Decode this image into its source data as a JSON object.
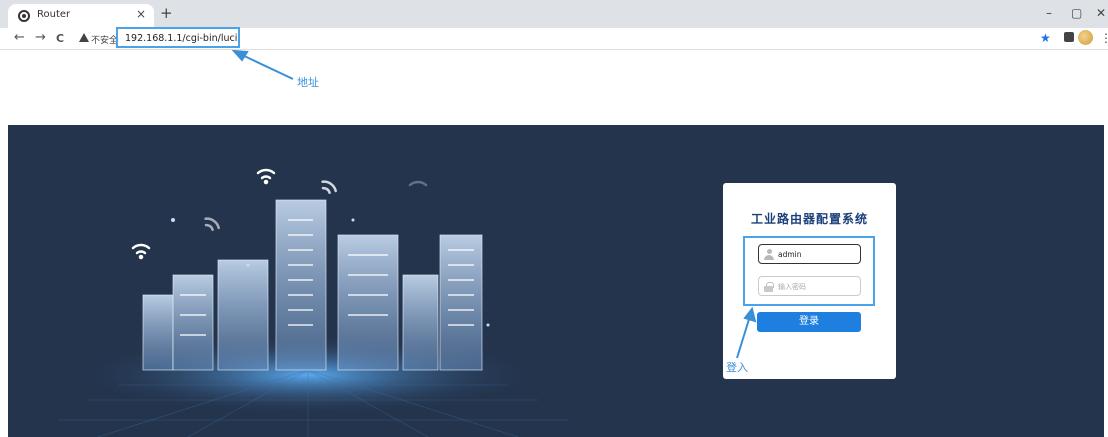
{
  "browser": {
    "tab_title": "Router",
    "tab_close": "×",
    "new_tab": "+",
    "win_minimize": "–",
    "win_restore": "▢",
    "win_close": "✕",
    "back": "←",
    "forward": "→",
    "reload": "C",
    "insecure_label": "不安全",
    "url": "192.168.1.1/cgi-bin/luci",
    "star": "★",
    "menu": "⋮"
  },
  "annotations": {
    "address": "地址",
    "login": "登入"
  },
  "login": {
    "title": "工业路由器配置系统",
    "username_value": "admin",
    "password_placeholder": "输入密码",
    "submit_label": "登录"
  },
  "colors": {
    "hero_bg": "#24344d",
    "accent": "#1e7fe0",
    "annotation": "#3a8fd6"
  }
}
